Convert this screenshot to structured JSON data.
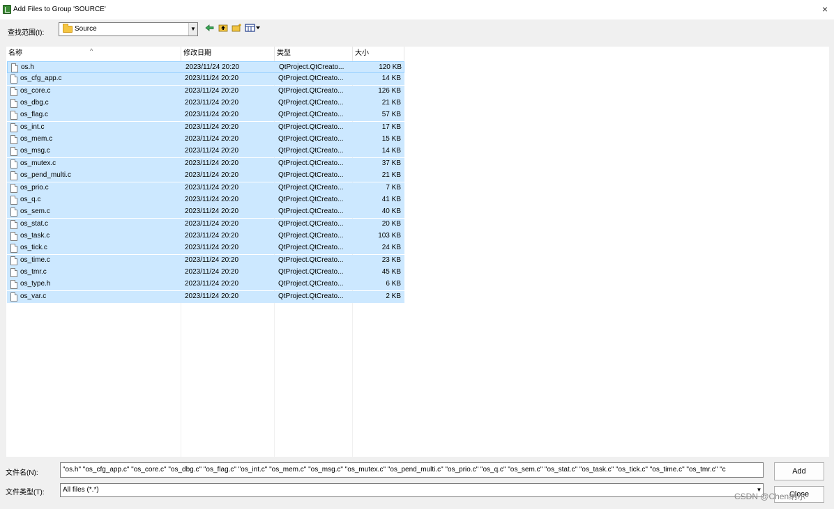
{
  "window": {
    "title": "Add Files to Group 'SOURCE'",
    "close_glyph": "×"
  },
  "lookin": {
    "label": "查找范围(I):",
    "value": "Source",
    "icon": "folder-icon"
  },
  "toolbar": {
    "icons": [
      "back-arrow-icon",
      "up-folder-icon",
      "new-folder-icon",
      "view-menu-icon"
    ]
  },
  "columns": {
    "name": "名称",
    "date": "修改日期",
    "type": "类型",
    "size": "大小",
    "sort_glyph": "^"
  },
  "files": [
    {
      "name": "os.h",
      "date": "2023/11/24 20:20",
      "type": "QtProject.QtCreato...",
      "size": "120 KB"
    },
    {
      "name": "os_cfg_app.c",
      "date": "2023/11/24 20:20",
      "type": "QtProject.QtCreato...",
      "size": "14 KB"
    },
    {
      "name": "os_core.c",
      "date": "2023/11/24 20:20",
      "type": "QtProject.QtCreato...",
      "size": "126 KB"
    },
    {
      "name": "os_dbg.c",
      "date": "2023/11/24 20:20",
      "type": "QtProject.QtCreato...",
      "size": "21 KB"
    },
    {
      "name": "os_flag.c",
      "date": "2023/11/24 20:20",
      "type": "QtProject.QtCreato...",
      "size": "57 KB"
    },
    {
      "name": "os_int.c",
      "date": "2023/11/24 20:20",
      "type": "QtProject.QtCreato...",
      "size": "17 KB"
    },
    {
      "name": "os_mem.c",
      "date": "2023/11/24 20:20",
      "type": "QtProject.QtCreato...",
      "size": "15 KB"
    },
    {
      "name": "os_msg.c",
      "date": "2023/11/24 20:20",
      "type": "QtProject.QtCreato...",
      "size": "14 KB"
    },
    {
      "name": "os_mutex.c",
      "date": "2023/11/24 20:20",
      "type": "QtProject.QtCreato...",
      "size": "37 KB"
    },
    {
      "name": "os_pend_multi.c",
      "date": "2023/11/24 20:20",
      "type": "QtProject.QtCreato...",
      "size": "21 KB"
    },
    {
      "name": "os_prio.c",
      "date": "2023/11/24 20:20",
      "type": "QtProject.QtCreato...",
      "size": "7 KB"
    },
    {
      "name": "os_q.c",
      "date": "2023/11/24 20:20",
      "type": "QtProject.QtCreato...",
      "size": "41 KB"
    },
    {
      "name": "os_sem.c",
      "date": "2023/11/24 20:20",
      "type": "QtProject.QtCreato...",
      "size": "40 KB"
    },
    {
      "name": "os_stat.c",
      "date": "2023/11/24 20:20",
      "type": "QtProject.QtCreato...",
      "size": "20 KB"
    },
    {
      "name": "os_task.c",
      "date": "2023/11/24 20:20",
      "type": "QtProject.QtCreato...",
      "size": "103 KB"
    },
    {
      "name": "os_tick.c",
      "date": "2023/11/24 20:20",
      "type": "QtProject.QtCreato...",
      "size": "24 KB"
    },
    {
      "name": "os_time.c",
      "date": "2023/11/24 20:20",
      "type": "QtProject.QtCreato...",
      "size": "23 KB"
    },
    {
      "name": "os_tmr.c",
      "date": "2023/11/24 20:20",
      "type": "QtProject.QtCreato...",
      "size": "45 KB"
    },
    {
      "name": "os_type.h",
      "date": "2023/11/24 20:20",
      "type": "QtProject.QtCreato...",
      "size": "6 KB"
    },
    {
      "name": "os_var.c",
      "date": "2023/11/24 20:20",
      "type": "QtProject.QtCreato...",
      "size": "2 KB"
    }
  ],
  "filename": {
    "label": "文件名(N):",
    "value": "\"os.h\" \"os_cfg_app.c\" \"os_core.c\" \"os_dbg.c\" \"os_flag.c\" \"os_int.c\" \"os_mem.c\" \"os_msg.c\" \"os_mutex.c\" \"os_pend_multi.c\" \"os_prio.c\" \"os_q.c\" \"os_sem.c\" \"os_stat.c\" \"os_task.c\" \"os_tick.c\" \"os_time.c\" \"os_tmr.c\" \"c"
  },
  "filetype": {
    "label": "文件类型(T):",
    "value": "All files (*.*)"
  },
  "buttons": {
    "add": "Add",
    "close": "Close"
  },
  "watermark": "CSDN @Chen纳尔",
  "colors": {
    "selection": "#cce8ff",
    "selection_border": "#99d1ff",
    "dialog_bg": "#f0f0f0"
  }
}
